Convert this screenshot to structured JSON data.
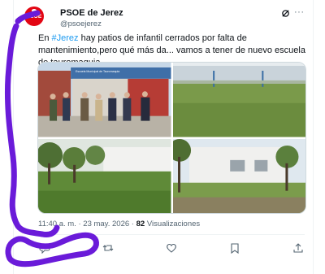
{
  "account": {
    "avatar_text": "PSOE",
    "name": "PSOE de Jerez",
    "handle": "@psoejerez"
  },
  "post": {
    "text_before": "En ",
    "hashtag": "#Jerez",
    "text_after": " hay patios de infantil cerrados por falta de mantenimiento,pero qué más da... vamos a tener de nuevo escuela de tauromaquia.",
    "time": "11:40 a. m.",
    "separator": " · ",
    "date": "23 may. 2026",
    "views_count": "82",
    "views_label": " Visualizaciones"
  },
  "banner": {
    "text": "Escuela Municipal de Tauromaquia"
  },
  "icons": {
    "grok": "grok-icon",
    "more": "more-icon",
    "reply": "reply-icon",
    "repost": "repost-icon",
    "like": "like-icon",
    "bookmark": "bookmark-icon",
    "share": "share-icon"
  },
  "colors": {
    "brand_red": "#e30613",
    "link_blue": "#1d9bf0",
    "scribble_purple": "#6a1bd9"
  }
}
